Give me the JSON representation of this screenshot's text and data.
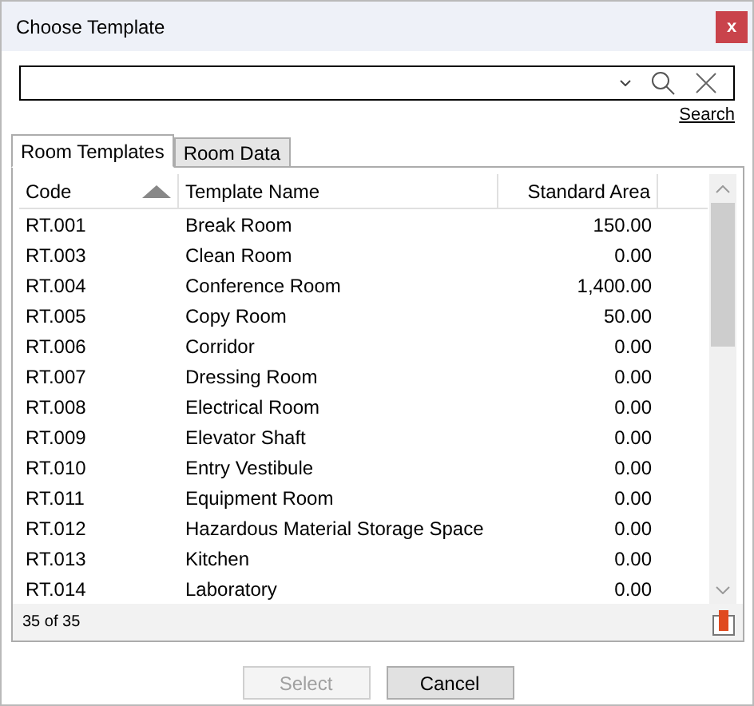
{
  "window": {
    "title": "Choose Template",
    "close": "x"
  },
  "search": {
    "link": "Search"
  },
  "tabs": [
    {
      "label": "Room Templates",
      "selected": true
    },
    {
      "label": "Room Data",
      "selected": false
    }
  ],
  "table": {
    "columns": [
      {
        "label": "Code",
        "sorted": true
      },
      {
        "label": "Template Name",
        "sorted": false
      },
      {
        "label": "Standard Area",
        "sorted": false
      }
    ],
    "rows": [
      [
        "RT.001",
        "Break Room",
        "150.00"
      ],
      [
        "RT.003",
        "Clean Room",
        "0.00"
      ],
      [
        "RT.004",
        "Conference Room",
        "1,400.00"
      ],
      [
        "RT.005",
        "Copy Room",
        "50.00"
      ],
      [
        "RT.006",
        "Corridor",
        "0.00"
      ],
      [
        "RT.007",
        "Dressing Room",
        "0.00"
      ],
      [
        "RT.008",
        "Electrical Room",
        "0.00"
      ],
      [
        "RT.009",
        "Elevator Shaft",
        "0.00"
      ],
      [
        "RT.010",
        "Entry Vestibule",
        "0.00"
      ],
      [
        "RT.011",
        "Equipment Room",
        "0.00"
      ],
      [
        "RT.012",
        "Hazardous Material Storage Space",
        "0.00"
      ],
      [
        "RT.013",
        "Kitchen",
        "0.00"
      ],
      [
        "RT.014",
        "Laboratory",
        "0.00"
      ]
    ]
  },
  "footer": {
    "count": "35 of 35"
  },
  "buttons": [
    {
      "label": "Select",
      "disabled": true
    },
    {
      "label": "Cancel",
      "disabled": false
    }
  ]
}
